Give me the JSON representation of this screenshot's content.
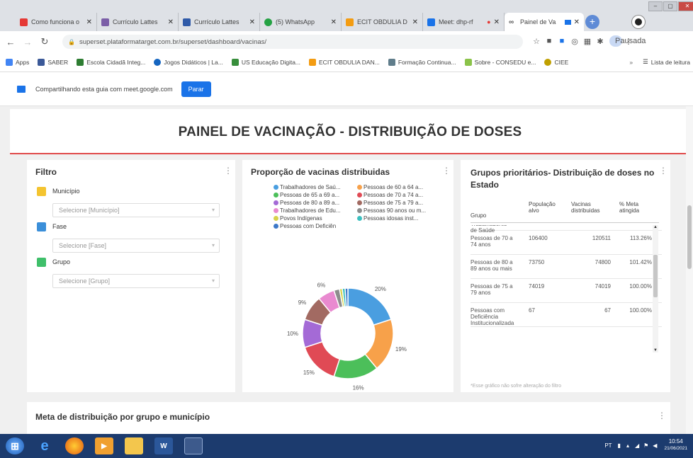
{
  "browser": {
    "tabs": [
      {
        "label": "Como funciona o",
        "color": "#e53935"
      },
      {
        "label": "Currículo Lattes",
        "color": "#7b5ea7"
      },
      {
        "label": "Currículo Lattes",
        "color": "#2f5aa8"
      },
      {
        "label": "(5) WhatsApp",
        "color": "#25a244"
      },
      {
        "label": "ECIT OBDULIA D",
        "color": "#f39c12"
      },
      {
        "label": "Meet: dhp-rf",
        "color": "#1a73e8"
      },
      {
        "label": "Painel de Va",
        "color": "#555555"
      }
    ],
    "new_tab": "+",
    "url": "superset.plataformatarget.com.br/superset/dashboard/vacinas/",
    "profile_status": "Pausada",
    "bookmarks": [
      {
        "label": "Apps",
        "color": "#4285f4"
      },
      {
        "label": "SABER",
        "color": "#3b5998"
      },
      {
        "label": "Escola Cidadã Integ...",
        "color": "#2e7d32"
      },
      {
        "label": "Jogos Didáticos | La...",
        "color": "#1565c0"
      },
      {
        "label": "US Educação Digita...",
        "color": "#388e3c"
      },
      {
        "label": "ECIT OBDULIA DAN...",
        "color": "#f39c12"
      },
      {
        "label": "Formação Continua...",
        "color": "#607d8b"
      },
      {
        "label": "Sobre - CONSEDU e...",
        "color": "#8bc34a"
      },
      {
        "label": "CIEE",
        "color": "#c0a000"
      }
    ],
    "reading_list": "Lista de leitura",
    "share_text": "Compartilhando esta guia com meet.google.com",
    "stop_label": "Parar"
  },
  "dashboard": {
    "title": "PAINEL DE VACINAÇÃO - DISTRIBUIÇÃO DE DOSES"
  },
  "filter": {
    "title": "Filtro",
    "fields": [
      {
        "label": "Município",
        "placeholder": "Selecione [Município]",
        "color": "#f4c430"
      },
      {
        "label": "Fase",
        "placeholder": "Selecione [Fase]",
        "color": "#3b8fd9"
      },
      {
        "label": "Grupo",
        "placeholder": "Selecione [Grupo]",
        "color": "#3fbf6a"
      }
    ]
  },
  "pie": {
    "title": "Proporção de vacinas distribuidas",
    "legend": [
      {
        "label": "Trabalhadores de Saú...",
        "color": "#4a9ee0"
      },
      {
        "label": "Pessoas de 60 a 64 a...",
        "color": "#f7a14a"
      },
      {
        "label": "Pessoas de 65 a 69 a...",
        "color": "#4cbf5a"
      },
      {
        "label": "Pessoas de 70 a 74 a...",
        "color": "#e04a55"
      },
      {
        "label": "Pessoas de 80 a 89 a...",
        "color": "#a46ad6"
      },
      {
        "label": "Pessoas de 75 a 79 a...",
        "color": "#a26a62"
      },
      {
        "label": "Trabalhadores de Edu...",
        "color": "#e98ad0"
      },
      {
        "label": "Pessoas 90 anos ou m...",
        "color": "#8d8d8d"
      },
      {
        "label": "Povos Indígenas",
        "color": "#d7d24a"
      },
      {
        "label": "Pessoas idosas inst...",
        "color": "#3cc0c0"
      },
      {
        "label": "Pessoas com Deficiên",
        "color": "#3d78c8"
      }
    ]
  },
  "table": {
    "title": "Grupos prioritários- Distribuição de doses no Estado",
    "headers": [
      "Grupo",
      "População alvo",
      "Vacinas distribuidas",
      "% Meta atingida"
    ],
    "rows": [
      {
        "grupo": "Trabalhadores de Saúde",
        "pop": "",
        "vac": "",
        "meta": ""
      },
      {
        "grupo": "Pessoas de 70 a 74 anos",
        "pop": "106400",
        "vac": "120511",
        "meta": "113.26%"
      },
      {
        "grupo": "Pessoas de 80 a 89 anos ou mais",
        "pop": "73750",
        "vac": "74800",
        "meta": "101.42%"
      },
      {
        "grupo": "Pessoas de 75 a 79 anos",
        "pop": "74019",
        "vac": "74019",
        "meta": "100.00%"
      },
      {
        "grupo": "Pessoas com Deficiência Institucionalizada",
        "pop": "67",
        "vac": "67",
        "meta": "100.00%"
      }
    ],
    "note": "*Esse gráfico não sofre alteração do filtro"
  },
  "bottom": {
    "title": "Meta de distribuição por grupo e município"
  },
  "taskbar": {
    "lang": "PT",
    "time": "10:54",
    "date": "21/06/2021"
  },
  "chart_data": {
    "type": "pie",
    "title": "Proporção de vacinas distribuidas",
    "categories": [
      "Trabalhadores de Saúde",
      "Pessoas de 60 a 64 anos",
      "Pessoas de 65 a 69 anos",
      "Pessoas de 70 a 74 anos",
      "Pessoas de 80 a 89 anos",
      "Pessoas de 75 a 79 anos",
      "Trabalhadores de Educação",
      "Pessoas 90 anos ou mais",
      "Povos Indígenas",
      "Pessoas idosas institucionalizadas",
      "Pessoas com Deficiência"
    ],
    "values": [
      20,
      19,
      16,
      15,
      10,
      9,
      6,
      2,
      1,
      1,
      1
    ],
    "labels": [
      "20%",
      "19%",
      "16%",
      "15%",
      "10%",
      "9%",
      "6%",
      "",
      "",
      "",
      ""
    ],
    "colors": [
      "#4a9ee0",
      "#f7a14a",
      "#4cbf5a",
      "#e04a55",
      "#a46ad6",
      "#a26a62",
      "#e98ad0",
      "#8d8d8d",
      "#d7d24a",
      "#3cc0c0",
      "#3d78c8"
    ],
    "donut": true,
    "legend": "top"
  }
}
